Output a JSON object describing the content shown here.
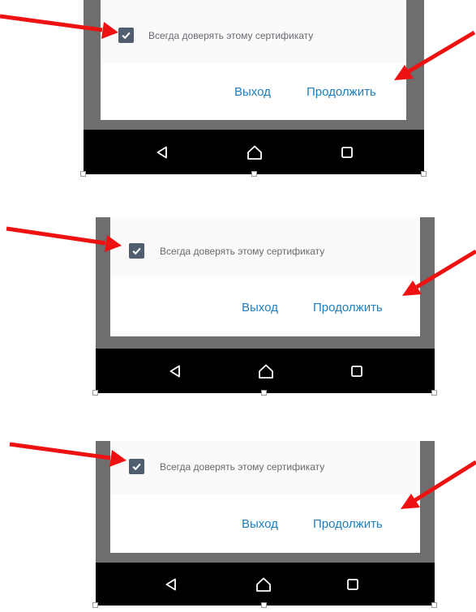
{
  "dialog": {
    "checkbox_label": "Всегда доверять этому сертификату",
    "checkbox_checked": true,
    "exit_label": "Выход",
    "continue_label": "Продолжить"
  },
  "navbar": {
    "icons": [
      "back-icon",
      "home-icon",
      "recents-icon"
    ]
  },
  "colors": {
    "accent": "#1b7fc0",
    "annotation_arrow": "#ee1111",
    "checkbox": "#505e70",
    "bezel": "#6e6e6e",
    "navbar": "#000000"
  }
}
